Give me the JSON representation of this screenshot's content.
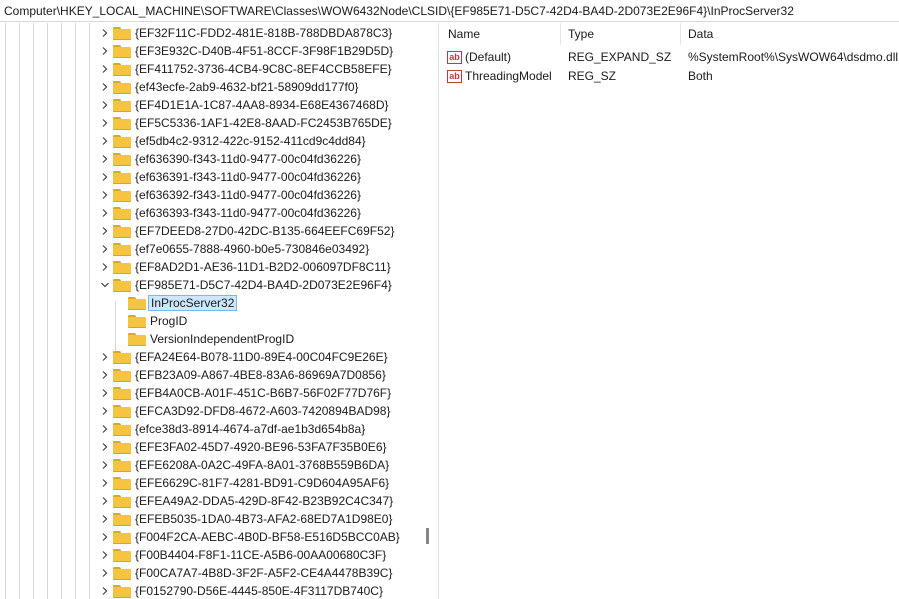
{
  "address": "Computer\\HKEY_LOCAL_MACHINE\\SOFTWARE\\Classes\\WOW6432Node\\CLSID\\{EF985E71-D5C7-42D4-BA4D-2D073E2E96F4}\\InProcServer32",
  "tree": {
    "items": [
      {
        "label": "{EF32F11C-FDD2-481E-818B-788DBDA878C3}",
        "expanded": false,
        "child": false
      },
      {
        "label": "{EF3E932C-D40B-4F51-8CCF-3F98F1B29D5D}",
        "expanded": false,
        "child": false
      },
      {
        "label": "{EF411752-3736-4CB4-9C8C-8EF4CCB58EFE}",
        "expanded": false,
        "child": false
      },
      {
        "label": "{ef43ecfe-2ab9-4632-bf21-58909dd177f0}",
        "expanded": false,
        "child": false
      },
      {
        "label": "{EF4D1E1A-1C87-4AA8-8934-E68E4367468D}",
        "expanded": false,
        "child": false
      },
      {
        "label": "{EF5C5336-1AF1-42E8-8AAD-FC2453B765DE}",
        "expanded": false,
        "child": false
      },
      {
        "label": "{ef5db4c2-9312-422c-9152-411cd9c4dd84}",
        "expanded": false,
        "child": false
      },
      {
        "label": "{ef636390-f343-11d0-9477-00c04fd36226}",
        "expanded": false,
        "child": false
      },
      {
        "label": "{ef636391-f343-11d0-9477-00c04fd36226}",
        "expanded": false,
        "child": false
      },
      {
        "label": "{ef636392-f343-11d0-9477-00c04fd36226}",
        "expanded": false,
        "child": false
      },
      {
        "label": "{ef636393-f343-11d0-9477-00c04fd36226}",
        "expanded": false,
        "child": false
      },
      {
        "label": "{EF7DEED8-27D0-42DC-B135-664EEFC69F52}",
        "expanded": false,
        "child": false
      },
      {
        "label": "{ef7e0655-7888-4960-b0e5-730846e03492}",
        "expanded": false,
        "child": false
      },
      {
        "label": "{EF8AD2D1-AE36-11D1-B2D2-006097DF8C11}",
        "expanded": false,
        "child": false
      },
      {
        "label": "{EF985E71-D5C7-42D4-BA4D-2D073E2E96F4}",
        "expanded": true,
        "child": false
      },
      {
        "label": "InProcServer32",
        "expanded": false,
        "child": true,
        "selected": true
      },
      {
        "label": "ProgID",
        "expanded": false,
        "child": true
      },
      {
        "label": "VersionIndependentProgID",
        "expanded": false,
        "child": true
      },
      {
        "label": "{EFA24E64-B078-11D0-89E4-00C04FC9E26E}",
        "expanded": false,
        "child": false
      },
      {
        "label": "{EFB23A09-A867-4BE8-83A6-86969A7D0856}",
        "expanded": false,
        "child": false
      },
      {
        "label": "{EFB4A0CB-A01F-451C-B6B7-56F02F77D76F}",
        "expanded": false,
        "child": false
      },
      {
        "label": "{EFCA3D92-DFD8-4672-A603-7420894BAD98}",
        "expanded": false,
        "child": false
      },
      {
        "label": "{efce38d3-8914-4674-a7df-ae1b3d654b8a}",
        "expanded": false,
        "child": false
      },
      {
        "label": "{EFE3FA02-45D7-4920-BE96-53FA7F35B0E6}",
        "expanded": false,
        "child": false
      },
      {
        "label": "{EFE6208A-0A2C-49FA-8A01-3768B559B6DA}",
        "expanded": false,
        "child": false
      },
      {
        "label": "{EFE6629C-81F7-4281-BD91-C9D604A95AF6}",
        "expanded": false,
        "child": false
      },
      {
        "label": "{EFEA49A2-DDA5-429D-8F42-B23B92C4C347}",
        "expanded": false,
        "child": false
      },
      {
        "label": "{EFEB5035-1DA0-4B73-AFA2-68ED7A1D98E0}",
        "expanded": false,
        "child": false
      },
      {
        "label": "{F004F2CA-AEBC-4B0D-BF58-E516D5BCC0AB}",
        "expanded": false,
        "child": false
      },
      {
        "label": "{F00B4404-F8F1-11CE-A5B6-00AA00680C3F}",
        "expanded": false,
        "child": false
      },
      {
        "label": "{F00CA7A7-4B8D-3F2F-A5F2-CE4A4478B39C}",
        "expanded": false,
        "child": false
      },
      {
        "label": "{F0152790-D56E-4445-850E-4F3117DB740C}",
        "expanded": false,
        "child": false
      }
    ]
  },
  "values": {
    "columns": {
      "name": "Name",
      "type": "Type",
      "data": "Data"
    },
    "rows": [
      {
        "icon": "ab",
        "name": "(Default)",
        "type": "REG_EXPAND_SZ",
        "data": "%SystemRoot%\\SysWOW64\\dsdmo.dll"
      },
      {
        "icon": "ab",
        "name": "ThreadingModel",
        "type": "REG_SZ",
        "data": "Both"
      }
    ]
  },
  "colors": {
    "folder": "#f5c542",
    "selection": "#cce8ff",
    "selection_border": "#7ab8e8",
    "string_icon": "#c23b3b"
  }
}
